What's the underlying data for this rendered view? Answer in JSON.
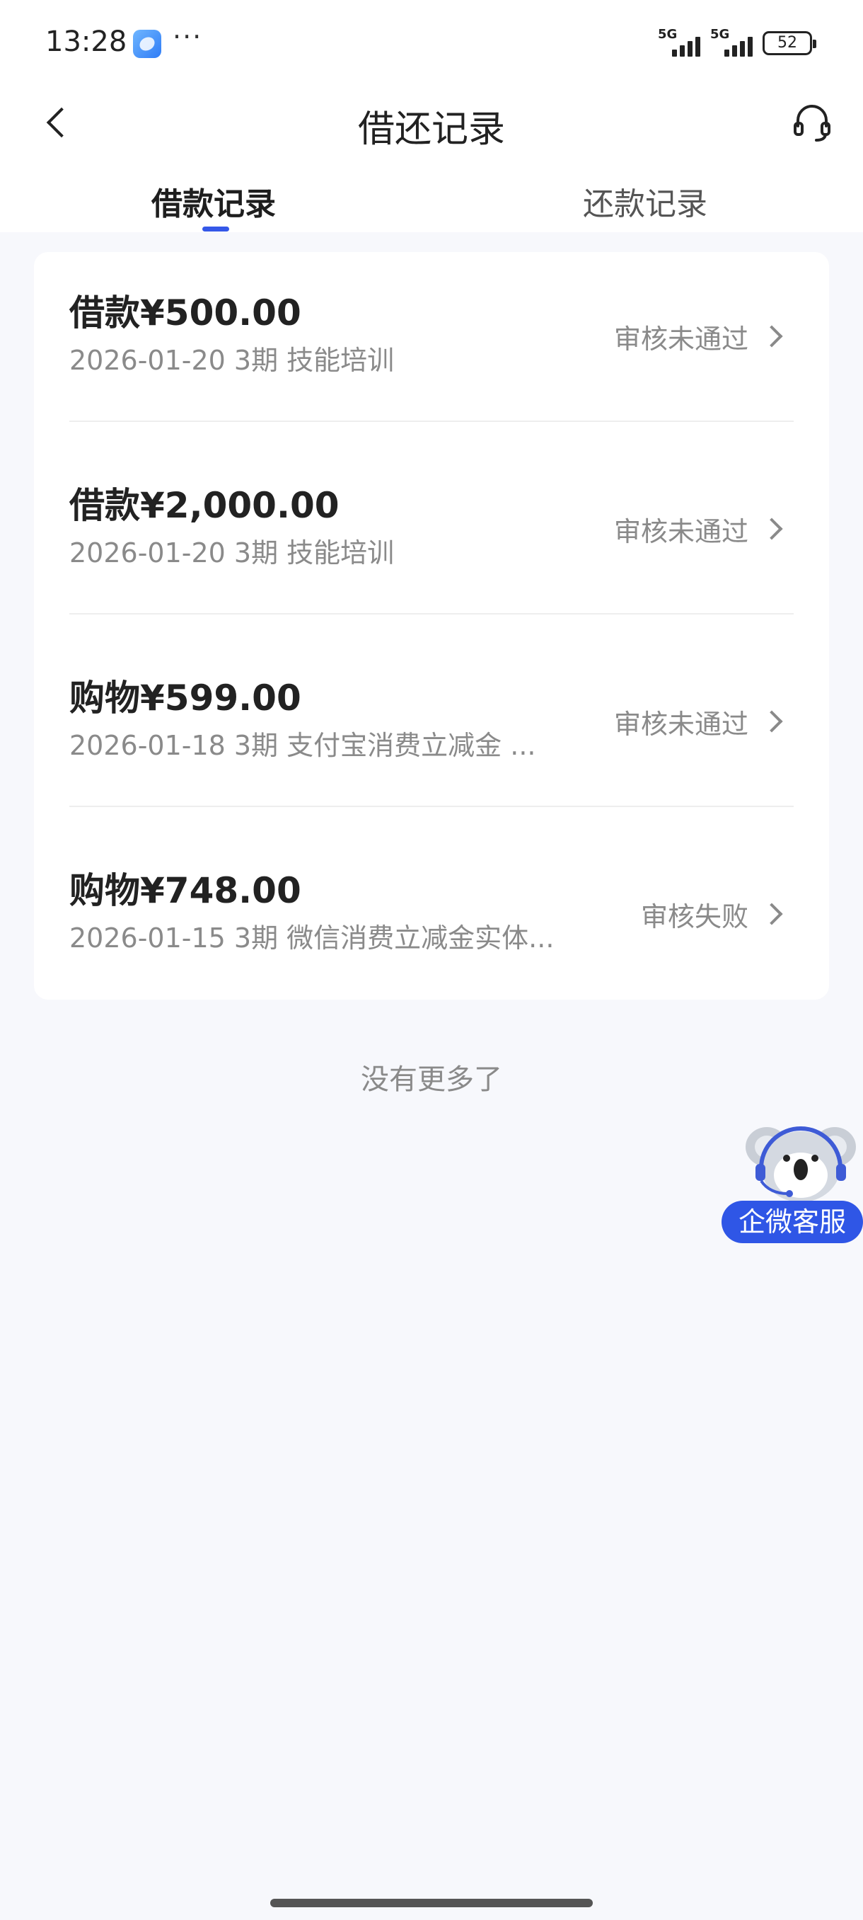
{
  "status_bar": {
    "time": "13:28",
    "more": "···",
    "signals": [
      {
        "label": "5G",
        "bars": 5
      },
      {
        "label": "5G",
        "bars": 5
      }
    ],
    "battery": "52"
  },
  "header": {
    "title": "借还记录",
    "back_icon": "chevron-left-icon",
    "service_icon": "headset-icon"
  },
  "tabs": [
    {
      "label": "借款记录",
      "active": true
    },
    {
      "label": "还款记录",
      "active": false
    }
  ],
  "accent_color": "#3558e8",
  "records": [
    {
      "amount": "借款¥500.00",
      "meta": "2026-01-20 3期  技能培训",
      "status": "审核未通过"
    },
    {
      "amount": "借款¥2,000.00",
      "meta": "2026-01-20 3期  技能培训",
      "status": "审核未通过"
    },
    {
      "amount": "购物¥599.00",
      "meta": "2026-01-18 3期  支付宝消费立减金 ...",
      "status": "审核未通过"
    },
    {
      "amount": "购物¥748.00",
      "meta": "2026-01-15 3期  微信消费立减金实体...",
      "status": "审核失败"
    }
  ],
  "footer_text": "没有更多了",
  "float_service": {
    "label": "企微客服",
    "icon": "koala-mascot-icon"
  }
}
